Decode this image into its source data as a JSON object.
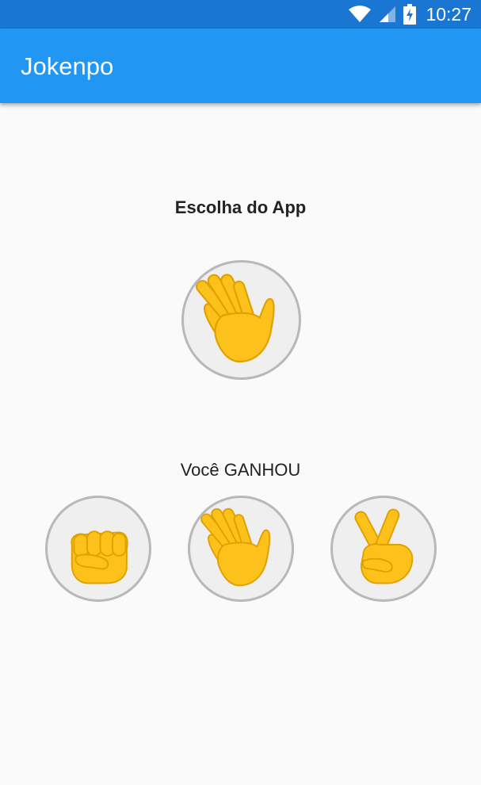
{
  "status_bar": {
    "time": "10:27",
    "icons": [
      "wifi-icon",
      "cell-signal-icon",
      "battery-charging-icon"
    ]
  },
  "app_bar": {
    "title": "Jokenpo"
  },
  "app_choice": {
    "label": "Escolha do App",
    "choice_icon": "paper-hand-icon"
  },
  "result": {
    "text": "Você GANHOU"
  },
  "options": [
    {
      "name": "rock",
      "icon": "rock-fist-icon"
    },
    {
      "name": "paper",
      "icon": "paper-hand-icon"
    },
    {
      "name": "scissors",
      "icon": "scissors-hand-icon"
    }
  ],
  "colors": {
    "status_bar": "#1976d2",
    "app_bar": "#2196f3",
    "background": "#fafafa",
    "emoji_skin": "#fcc21b",
    "emoji_outline": "#e5a100"
  }
}
